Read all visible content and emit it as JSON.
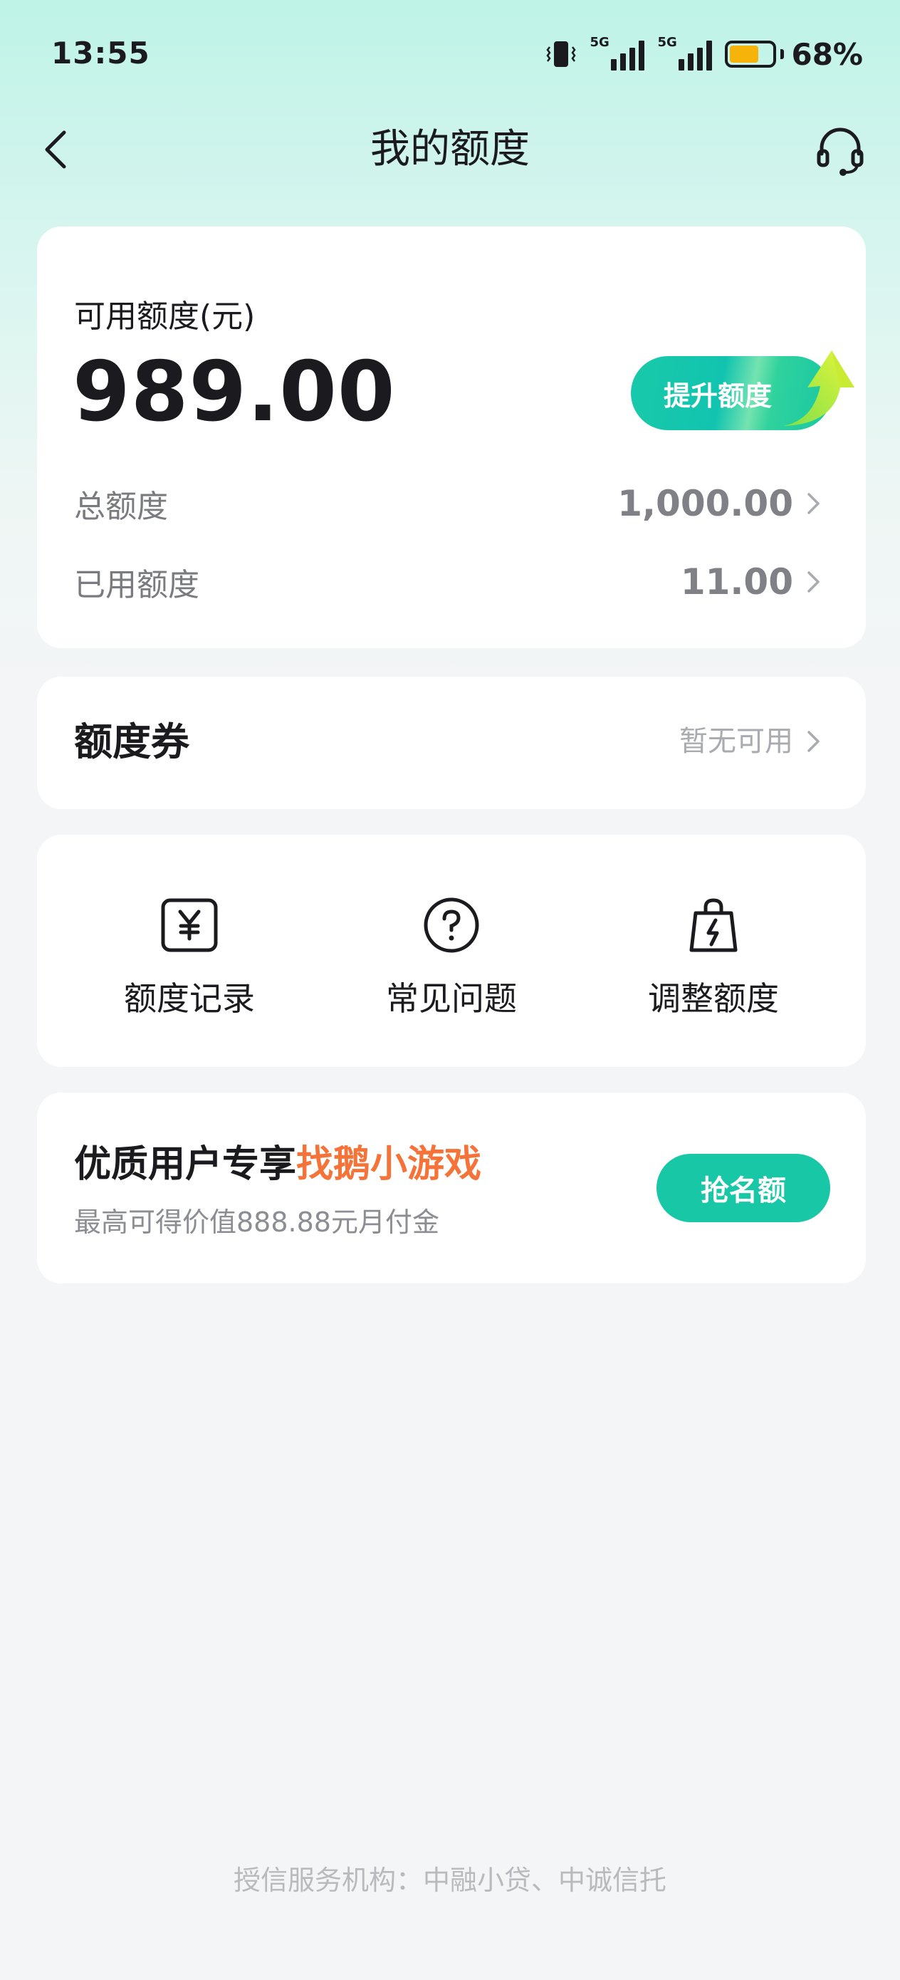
{
  "status_bar": {
    "time": "13:55",
    "network_1": "5G",
    "network_2": "5G",
    "battery_percent": "68%",
    "battery_level": 0.68,
    "battery_color": "#f6b40a"
  },
  "nav": {
    "title": "我的额度",
    "back_icon": "chevron-left-icon",
    "service_icon": "headset-icon"
  },
  "quota": {
    "available_label": "可用额度(元)",
    "available_value": "989.00",
    "raise_button": "提升额度",
    "total_label": "总额度",
    "total_value": "1,000.00",
    "used_label": "已用额度",
    "used_value": "11.00"
  },
  "coupon": {
    "title": "额度券",
    "status": "暂无可用"
  },
  "actions": [
    {
      "label": "额度记录",
      "icon": "yen-receipt-icon"
    },
    {
      "label": "常见问题",
      "icon": "question-circle-icon"
    },
    {
      "label": "调整额度",
      "icon": "lightning-bag-icon"
    }
  ],
  "promo": {
    "title_prefix": "优质用户专享",
    "title_highlight": "找鹅小游戏",
    "subtitle": "最高可得价值888.88元月付金",
    "button": "抢名额",
    "highlight_color": "#f57238",
    "accent_color": "#17c7a6"
  },
  "footer": {
    "text": "授信服务机构：中融小贷、中诚信托"
  }
}
